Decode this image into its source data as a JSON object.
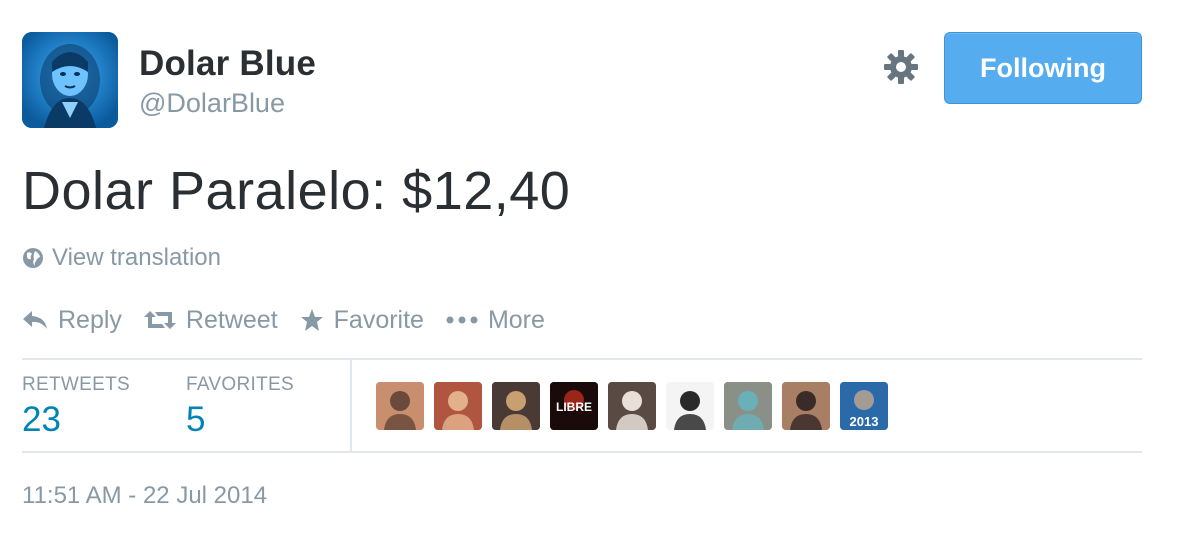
{
  "author": {
    "fullname": "Dolar Blue",
    "username": "@DolarBlue",
    "avatar_icon": "dollar-portrait-avatar"
  },
  "follow_button": {
    "label": "Following",
    "color": "#55acee"
  },
  "settings_icon": "gear-icon",
  "tweet": {
    "text": "Dolar Paralelo: $12,40",
    "view_translation": "View translation"
  },
  "actions": {
    "reply": "Reply",
    "retweet": "Retweet",
    "favorite": "Favorite",
    "more": "More"
  },
  "stats": {
    "retweets_label": "RETWEETS",
    "retweets_count": "23",
    "favorites_label": "FAVORITES",
    "favorites_count": "5",
    "count_color": "#0084b4"
  },
  "faces": [
    {
      "bg": "#c98e6e",
      "accent": "#6a4a3a"
    },
    {
      "bg": "#b0553f",
      "accent": "#e2b08a"
    },
    {
      "bg": "#4a3a36",
      "accent": "#c8a070"
    },
    {
      "bg": "#1a0a0a",
      "accent": "#d23020",
      "text": "LIBRE"
    },
    {
      "bg": "#5a4a44",
      "accent": "#e8e0d8"
    },
    {
      "bg": "#f4f4f4",
      "accent": "#2a2a2a"
    },
    {
      "bg": "#8a8f88",
      "accent": "#6ab0b8"
    },
    {
      "bg": "#a87e64",
      "accent": "#3a2a28"
    },
    {
      "bg": "#2a6aa8",
      "accent": "#d8b090",
      "text": "2013"
    }
  ],
  "timestamp": "11:51 AM - 22 Jul 2014"
}
